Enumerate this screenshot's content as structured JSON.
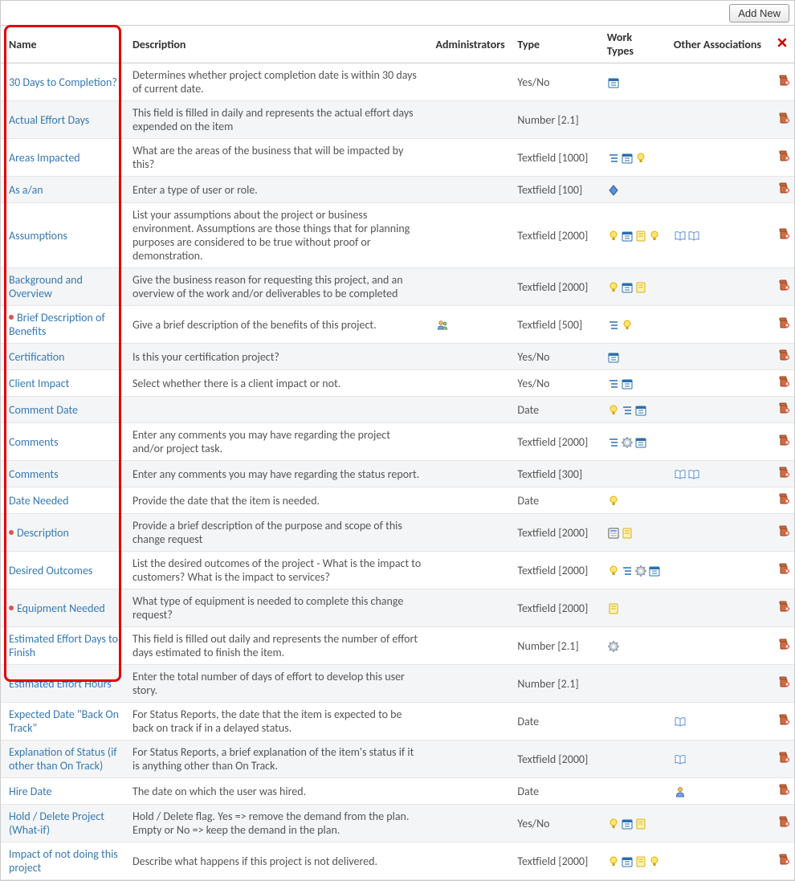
{
  "toolbar": {
    "add_new": "Add New"
  },
  "headers": {
    "name": "Name",
    "description": "Description",
    "administrators": "Administrators",
    "type": "Type",
    "work_types": "Work Types",
    "other_associations": "Other Associations",
    "delete": "✖"
  },
  "rows": [
    {
      "required": false,
      "name": "30 Days to Completion?",
      "description": "Determines whether project completion date is within 30 days of current date.",
      "admins": [],
      "type": "Yes/No",
      "work_types": [
        "calendar"
      ],
      "other": []
    },
    {
      "required": false,
      "name": "Actual Effort Days",
      "description": "This field is filled in daily and represents the actual effort days expended on the item",
      "admins": [],
      "type": "Number [2.1]",
      "work_types": [],
      "other": []
    },
    {
      "required": false,
      "name": "Areas Impacted",
      "description": "What are the areas of the business that will be impacted by this?",
      "admins": [],
      "type": "Textfield [1000]",
      "work_types": [
        "list",
        "calendar",
        "bulb"
      ],
      "other": []
    },
    {
      "required": false,
      "name": "As a/an",
      "description": "Enter a type of user or role.",
      "admins": [],
      "type": "Textfield [100]",
      "work_types": [
        "diamond"
      ],
      "other": []
    },
    {
      "required": false,
      "name": "Assumptions",
      "description": "List your assumptions about the project or business environment. Assumptions are those things that for planning purposes are considered to be true without proof or demonstration.",
      "admins": [],
      "type": "Textfield [2000]",
      "work_types": [
        "bulb",
        "calendar",
        "note",
        "bulb"
      ],
      "other": [
        "book",
        "book"
      ]
    },
    {
      "required": false,
      "name": "Background and Overview",
      "description": "Give the business reason for requesting this project, and an overview of the work and/or deliverables to be completed",
      "admins": [],
      "type": "Textfield [2000]",
      "work_types": [
        "bulb",
        "calendar",
        "note"
      ],
      "other": []
    },
    {
      "required": true,
      "name": "Brief Description of Benefits",
      "description": "Give a brief description of the benefits of this project.",
      "admins": [
        "people"
      ],
      "type": "Textfield [500]",
      "work_types": [
        "list",
        "bulb"
      ],
      "other": []
    },
    {
      "required": false,
      "name": "Certification",
      "description": "Is this your certification project?",
      "admins": [],
      "type": "Yes/No",
      "work_types": [
        "calendar"
      ],
      "other": []
    },
    {
      "required": false,
      "name": "Client Impact",
      "description": "Select whether there is a client impact or not.",
      "admins": [],
      "type": "Yes/No",
      "work_types": [
        "list",
        "calendar"
      ],
      "other": []
    },
    {
      "required": false,
      "name": "Comment Date",
      "description": "",
      "admins": [],
      "type": "Date",
      "work_types": [
        "bulb",
        "list",
        "calendar"
      ],
      "other": []
    },
    {
      "required": false,
      "name": "Comments",
      "description": "Enter any comments you may have regarding the project and/or project task.",
      "admins": [],
      "type": "Textfield [2000]",
      "work_types": [
        "list",
        "gear",
        "calendar"
      ],
      "other": []
    },
    {
      "required": false,
      "name": "Comments",
      "description": "Enter any comments you may have regarding the status report.",
      "admins": [],
      "type": "Textfield [300]",
      "work_types": [],
      "other": [
        "book",
        "book"
      ]
    },
    {
      "required": false,
      "name": "Date Needed",
      "description": "Provide the date that the item is needed.",
      "admins": [],
      "type": "Date",
      "work_types": [
        "bulb"
      ],
      "other": []
    },
    {
      "required": true,
      "name": "Description",
      "description": "Provide a brief description of the purpose and scope of this change request",
      "admins": [],
      "type": "Textfield [2000]",
      "work_types": [
        "form",
        "note"
      ],
      "other": []
    },
    {
      "required": false,
      "name": "Desired Outcomes",
      "description": "List the desired outcomes of the project - What is the impact to customers? What is the impact to services?",
      "admins": [],
      "type": "Textfield [2000]",
      "work_types": [
        "bulb",
        "list",
        "gear",
        "calendar"
      ],
      "other": []
    },
    {
      "required": true,
      "name": "Equipment Needed",
      "description": "What type of equipment is needed to complete this change request?",
      "admins": [],
      "type": "Textfield [2000]",
      "work_types": [
        "note"
      ],
      "other": []
    },
    {
      "required": false,
      "name": "Estimated Effort Days to Finish",
      "description": "This field is filled out daily and represents the number of effort days estimated to finish the item.",
      "admins": [],
      "type": "Number [2.1]",
      "work_types": [
        "gear"
      ],
      "other": []
    },
    {
      "required": false,
      "name": "Estimated Effort Hours",
      "description": "Enter the total number of days of effort to develop this user story.",
      "admins": [],
      "type": "Number [2.1]",
      "work_types": [],
      "other": []
    },
    {
      "required": false,
      "name": "Expected Date \"Back On Track\"",
      "description": "For Status Reports, the date that the item is expected to be back on track if in a delayed status.",
      "admins": [],
      "type": "Date",
      "work_types": [],
      "other": [
        "book"
      ]
    },
    {
      "required": false,
      "name": "Explanation of Status (if other than On Track)",
      "description": "For Status Reports, a brief explanation of the item's status if it is anything other than On Track.",
      "admins": [],
      "type": "Textfield [2000]",
      "work_types": [],
      "other": [
        "book"
      ]
    },
    {
      "required": false,
      "name": "Hire Date",
      "description": "The date on which the user was hired.",
      "admins": [],
      "type": "Date",
      "work_types": [],
      "other": [
        "person"
      ]
    },
    {
      "required": false,
      "name": "Hold / Delete Project (What-if)",
      "description": "Hold / Delete flag. Yes => remove the demand from the plan. Empty or No => keep the demand in the plan.",
      "admins": [],
      "type": "Yes/No",
      "work_types": [
        "bulb",
        "calendar",
        "note"
      ],
      "other": []
    },
    {
      "required": false,
      "name": "Impact of not doing this project",
      "description": "Describe what happens if this project is not delivered.",
      "admins": [],
      "type": "Textfield [2000]",
      "work_types": [
        "bulb",
        "calendar",
        "note",
        "bulb"
      ],
      "other": []
    }
  ]
}
